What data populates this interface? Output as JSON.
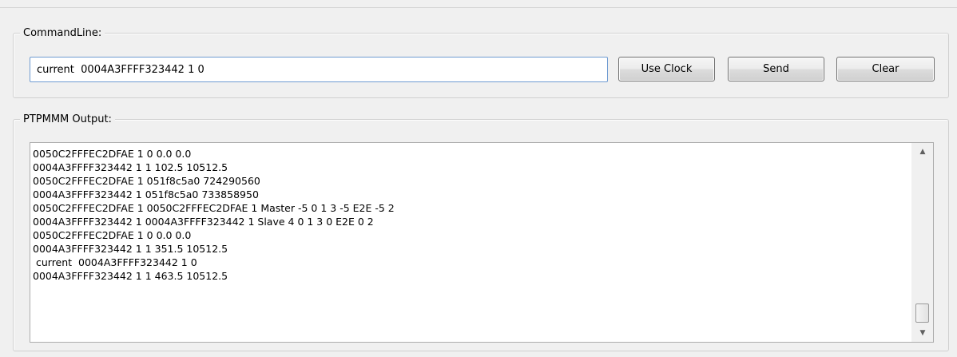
{
  "command_group": {
    "title": "CommandLine:",
    "input_value": "current  0004A3FFFF323442 1 0",
    "buttons": {
      "use_clock": "Use Clock",
      "send": "Send",
      "clear": "Clear"
    }
  },
  "output_group": {
    "title": "PTPMMM Output:",
    "lines": [
      "0050C2FFFEC2DFAE 1 0 0.0 0.0",
      "0004A3FFFF323442 1 1 102.5 10512.5",
      "0050C2FFFEC2DFAE 1 051f8c5a0 724290560",
      "0004A3FFFF323442 1 051f8c5a0 733858950",
      "0050C2FFFEC2DFAE 1 0050C2FFFEC2DFAE 1 Master -5 0 1 3 -5 E2E -5 2",
      "0004A3FFFF323442 1 0004A3FFFF323442 1 Slave 4 0 1 3 0 E2E 0 2",
      "0050C2FFFEC2DFAE 1 0 0.0 0.0",
      "0004A3FFFF323442 1 1 351.5 10512.5",
      " current  0004A3FFFF323442 1 0",
      "0004A3FFFF323442 1 1 463.5 10512.5"
    ],
    "scroll_position": 1.0,
    "icons": {
      "scroll_up": "scroll-up-arrow-icon",
      "scroll_down": "scroll-down-arrow-icon"
    }
  }
}
